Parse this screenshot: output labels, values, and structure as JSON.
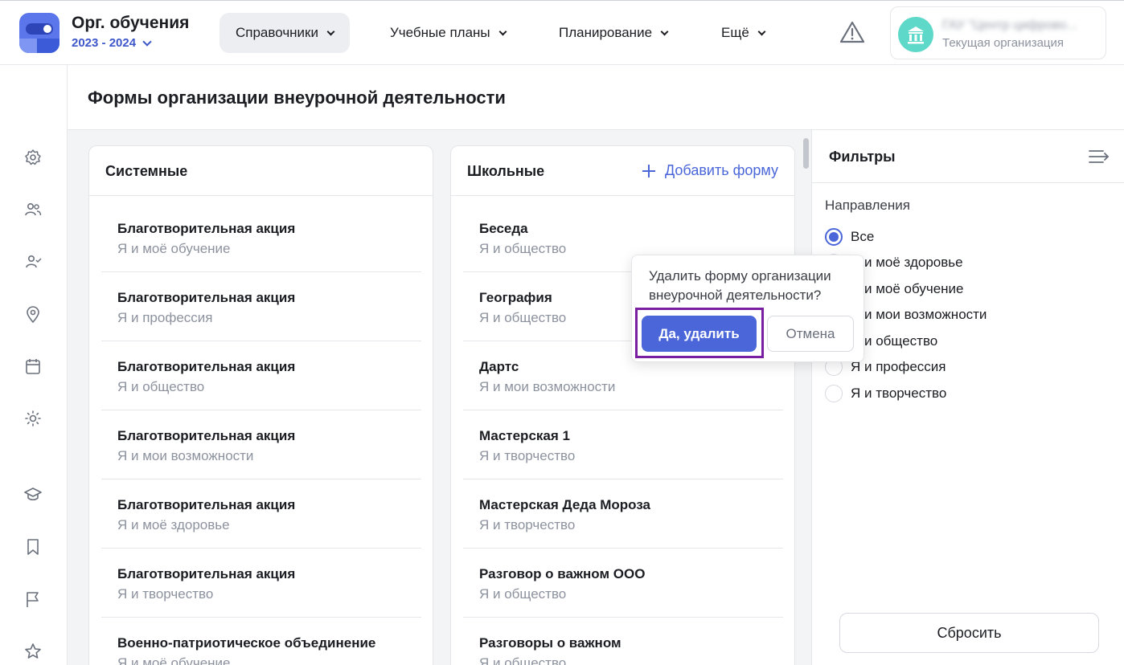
{
  "header": {
    "brand_title": "Орг. обучения",
    "brand_year": "2023 - 2024",
    "nav": [
      {
        "label": "Справочники",
        "active": true
      },
      {
        "label": "Учебные планы",
        "active": false
      },
      {
        "label": "Планирование",
        "active": false
      },
      {
        "label": "Ещё",
        "active": false
      }
    ],
    "warning_icon": "warning-triangle-icon",
    "org": {
      "name": "ГАУ \"Центр цифрово...",
      "subtitle": "Текущая организация",
      "avatar_icon": "bank-building-icon",
      "avatar_color": "#5ed8c8"
    }
  },
  "sidebar": {
    "icons": [
      "settings-icon",
      "users-icon",
      "user-check-icon",
      "location-pin-icon",
      "calendar-icon",
      "sun-icon",
      "graduation-cap-icon",
      "bookmark-icon",
      "flag-icon",
      "star-icon"
    ]
  },
  "page": {
    "title": "Формы организации внеурочной деятельности"
  },
  "system_panel": {
    "title": "Системные",
    "items": [
      {
        "title": "Благотворительная акция",
        "direction": "Я и моё обучение"
      },
      {
        "title": "Благотворительная акция",
        "direction": "Я и профессия"
      },
      {
        "title": "Благотворительная акция",
        "direction": "Я и общество"
      },
      {
        "title": "Благотворительная акция",
        "direction": "Я и мои возможности"
      },
      {
        "title": "Благотворительная акция",
        "direction": "Я и моё здоровье"
      },
      {
        "title": "Благотворительная акция",
        "direction": "Я и творчество"
      },
      {
        "title": "Военно-патриотическое объединение",
        "direction": "Я и моё обучение"
      }
    ]
  },
  "school_panel": {
    "title": "Школьные",
    "add_label": "Добавить форму",
    "items": [
      {
        "title": "Беседа",
        "direction": "Я и общество"
      },
      {
        "title": "География",
        "direction": "Я и общество"
      },
      {
        "title": "Дартс",
        "direction": "Я и мои возможности"
      },
      {
        "title": "Мастерская 1",
        "direction": "Я и творчество"
      },
      {
        "title": "Мастерская Деда Мороза",
        "direction": "Я и творчество"
      },
      {
        "title": "Разговор о важном ООО",
        "direction": "Я и общество"
      },
      {
        "title": "Разговоры о важном",
        "direction": "Я и общество"
      }
    ]
  },
  "confirm_popover": {
    "question": "Удалить форму организации внеурочной деятельности?",
    "confirm_label": "Да, удалить",
    "cancel_label": "Отмена"
  },
  "filters": {
    "title": "Фильтры",
    "group_label": "Направления",
    "options": [
      {
        "label": "Все",
        "selected": true
      },
      {
        "label": "Я и моё здоровье",
        "selected": false
      },
      {
        "label": "Я и моё обучение",
        "selected": false
      },
      {
        "label": "Я и мои возможности",
        "selected": false
      },
      {
        "label": "Я и общество",
        "selected": false
      },
      {
        "label": "Я и профессия",
        "selected": false
      },
      {
        "label": "Я и творчество",
        "selected": false
      }
    ],
    "reset_label": "Сбросить"
  },
  "colors": {
    "accent": "#4a66d9",
    "highlight_border": "#7b1fa2"
  }
}
